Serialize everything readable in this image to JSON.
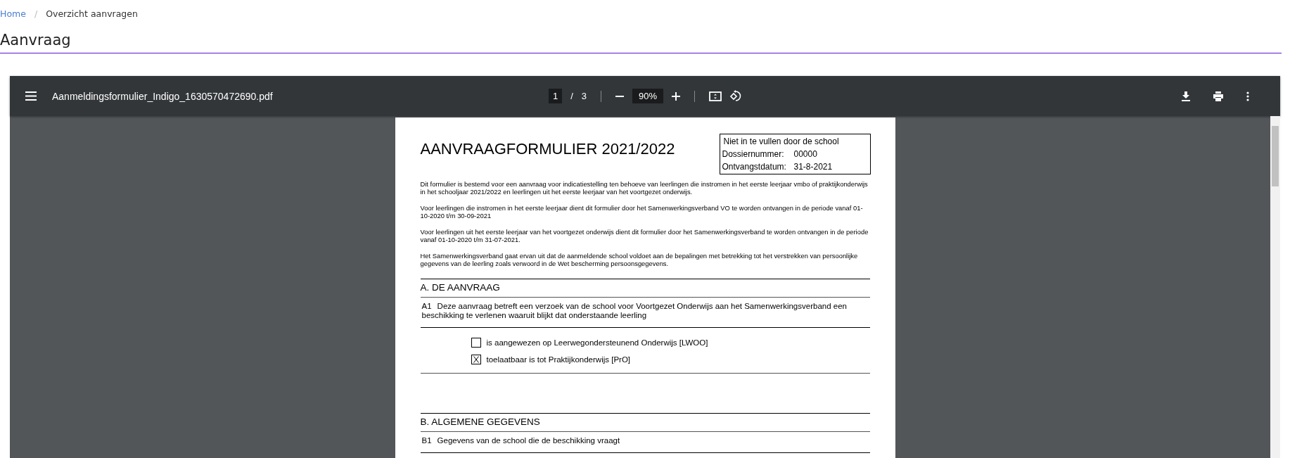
{
  "breadcrumb": [
    {
      "label": "Home",
      "kind": "link"
    },
    {
      "label": "Overzicht aanvragen",
      "kind": "current"
    }
  ],
  "breadcrumb_separator": "/",
  "page_title": "Aanvraag",
  "pdf_viewer": {
    "file_name": "Aanmeldingsformulier_Indigo_1630570472690.pdf",
    "page_number": "1",
    "page_separator": "/",
    "page_count": "3",
    "zoom": "90%"
  },
  "document": {
    "title": "AANVRAAGFORMULIER 2021/2022",
    "office_box": {
      "heading": "Niet in te vullen door de school",
      "fields": [
        {
          "label": "Dossiernummer:",
          "value": "00000"
        },
        {
          "label": "Ontvangstdatum:",
          "value": "31-8-2021"
        }
      ]
    },
    "paragraphs": [
      "Dit formulier is bestemd voor een aanvraag voor indicatiestelling ten behoeve van leerlingen die instromen in het eerste leerjaar vmbo of praktijkonderwijs in het schooljaar 2021/2022 en leerlingen uit het eerste leerjaar van het voortgezet onderwijs.",
      "Voor leerlingen die instromen in het eerste leerjaar dient dit formulier door het Samenwerkingsverband VO te worden ontvangen in de periode vanaf 01-10-2020 t/m 30-09-2021",
      "Voor leerlingen uit het eerste leerjaar van het voortgezet onderwijs dient dit formulier door het Samenwerkingsverband te worden ontvangen in de periode vanaf 01-10-2020 t/m 31-07-2021.",
      "Het Samenwerkingsverband gaat ervan uit dat de aanmeldende school voldoet aan de bepalingen met betrekking tot het verstrekken van persoonlijke gegevens van de leerling zoals verwoord in de Wet bescherming persoonsgegevens."
    ],
    "sections": [
      {
        "heading": "A. DE AANVRAAG",
        "question": {
          "number": "A1",
          "text": "Deze aanvraag betreft een verzoek van de school voor Voortgezet Onderwijs aan het Samenwerkingsverband een beschikking te verlenen waaruit blijkt dat onderstaande leerling"
        },
        "options": [
          {
            "label": "is aangewezen op Leerwegondersteunend Onderwijs [LWOO]",
            "checked": false
          },
          {
            "label": "toelaatbaar is tot Praktijkonderwijs [PrO]",
            "checked": true
          }
        ]
      },
      {
        "heading": "B. ALGEMENE GEGEVENS",
        "question": {
          "number": "B1",
          "text": "Gegevens van de school die de beschikking vraagt"
        }
      }
    ]
  }
}
